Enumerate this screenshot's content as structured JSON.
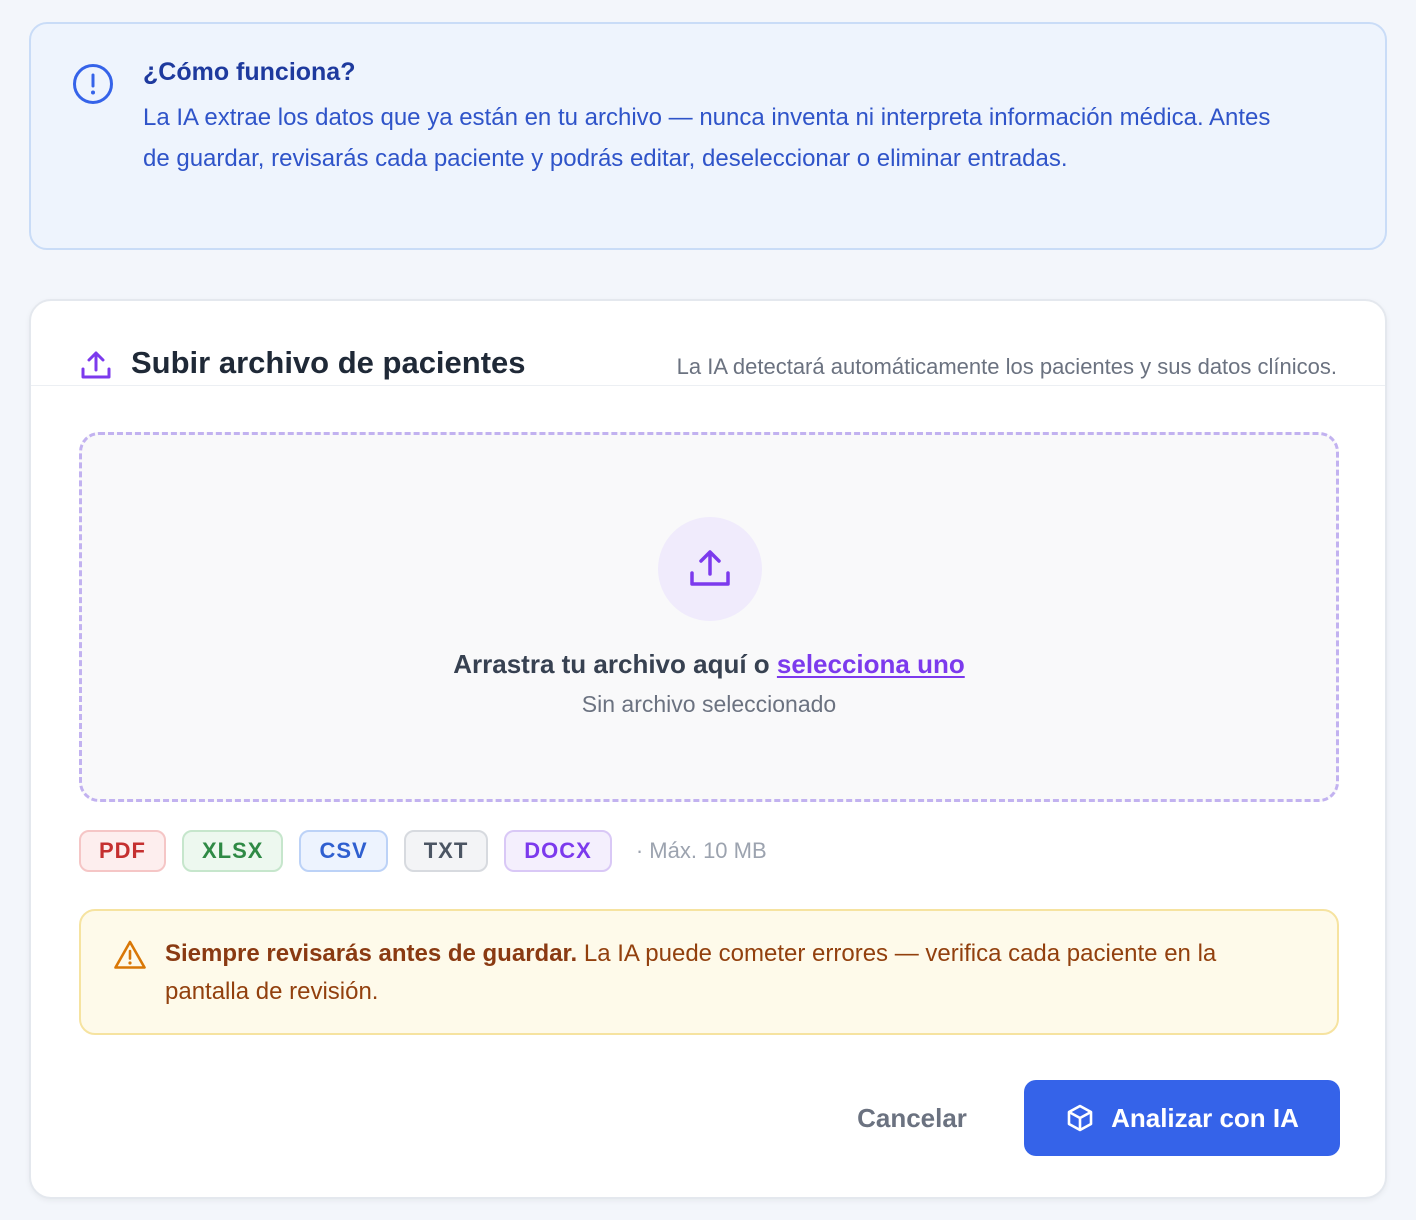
{
  "info": {
    "icon": "info-circle-icon",
    "title": "¿Cómo funciona?",
    "body": "La IA extrae los datos que ya están en tu archivo — nunca inventa ni interpreta información médica. Antes de guardar, revisarás cada paciente y podrás editar, deseleccionar o eliminar entradas."
  },
  "upload_card": {
    "icon": "upload-icon",
    "title": "Subir archivo de pacientes",
    "subtitle": "La IA detectará automáticamente los pacientes y sus datos clínicos.",
    "dropzone": {
      "icon": "upload-icon",
      "prompt": "Arrastra tu archivo aquí o",
      "link": "selecciona uno",
      "status": "Sin archivo seleccionado"
    },
    "formats": [
      "PDF",
      "XLSX",
      "CSV",
      "TXT",
      "DOCX"
    ],
    "max_size": "· Máx. 10 MB",
    "warning": {
      "icon": "warning-triangle-icon",
      "strong": "Siempre revisarás antes de guardar.",
      "text": " La IA puede cometer errores — verifica cada paciente en la pantalla de revisión."
    },
    "actions": {
      "cancel": "Cancelar",
      "analyze": "Analizar con IA",
      "analyze_icon": "cube-icon"
    }
  },
  "colors": {
    "primary": "#3563e9",
    "accent_purple": "#7c3aed",
    "info_bg": "#eef4fd",
    "warning_bg": "#fefaea"
  }
}
